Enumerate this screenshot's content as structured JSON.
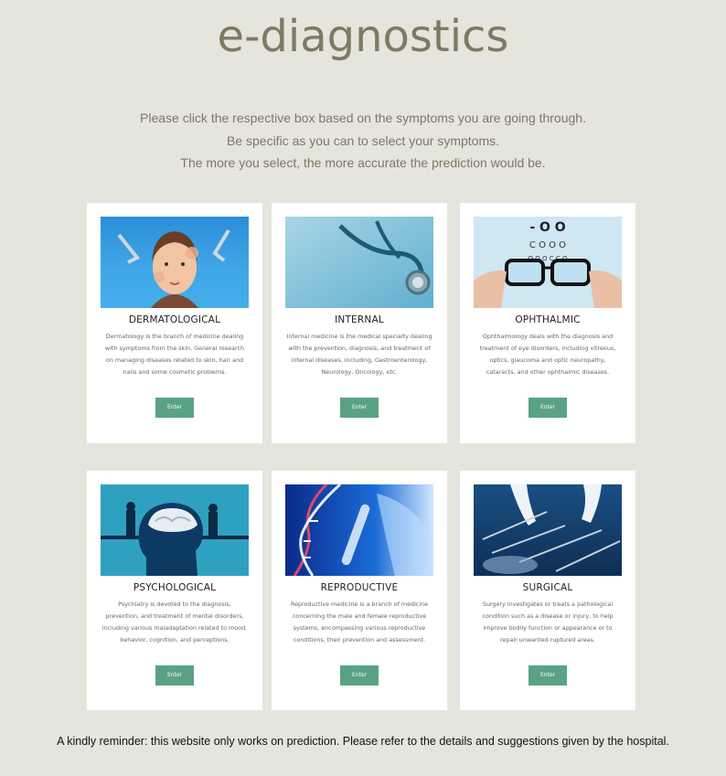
{
  "header": {
    "title": "e-diagnostics"
  },
  "intro": {
    "lines": [
      "Please click the respective box based on the symptoms you are going through.",
      "Be specific as you can to select your symptoms.",
      "The more you select, the more accurate the prediction would be."
    ]
  },
  "cards": [
    {
      "name": "DERMATOLOGICAL",
      "description": "Dermatology is the branch of medicine dealing with symptoms from the skin. General research on managing diseases related to skin, hair and nails and some cosmetic problems.",
      "button": "Enter",
      "image": "dermatology-illustration"
    },
    {
      "name": "INTERNAL",
      "description": "Internal medicine is the medical specialty dealing with the prevention, diagnosis, and treatment of internal diseases, including, Gastroenterology, Neurology, Oncology, etc.",
      "button": "Enter",
      "image": "stethoscope-photo"
    },
    {
      "name": "OPHTHALMIC",
      "description": "Ophthalmology deals with the diagnosis and treatment of eye disorders, including vitreous, optics, glaucoma and optic neuropathy, cataracts, and other ophthalmic diseases.",
      "button": "Enter",
      "image": "eyeglasses-eye-chart-photo"
    },
    {
      "name": "PSYCHOLOGICAL",
      "description": "Psychiatry is devoted to the diagnosis, prevention, and treatment of mental disorders, including various maladaptation related to mood, behavior, cognition, and perceptions.",
      "button": "Enter",
      "image": "head-brain-illustration"
    },
    {
      "name": "REPRODUCTIVE",
      "description": "Reproductive medicine is a branch of medicine concerning the male and female reproductive systems, encompassing various reproductive conditions, their prevention and assessment.",
      "button": "Enter",
      "image": "dna-test-tube-photo"
    },
    {
      "name": "SURGICAL",
      "description": "Surgery investigates or treats a pathological condition such as a disease or injury, to help improve bodily function or appearance or to repair unwanted ruptured areas.",
      "button": "Enter",
      "image": "surgical-instruments-photo"
    }
  ],
  "footer": {
    "reminder": "A kindly reminder: this website only works on prediction. Please refer to the details and suggestions given by the hospital."
  },
  "colors": {
    "background": "#e5e5dd",
    "title": "#7d7a64",
    "button": "#5aa285",
    "card": "#ffffff"
  }
}
